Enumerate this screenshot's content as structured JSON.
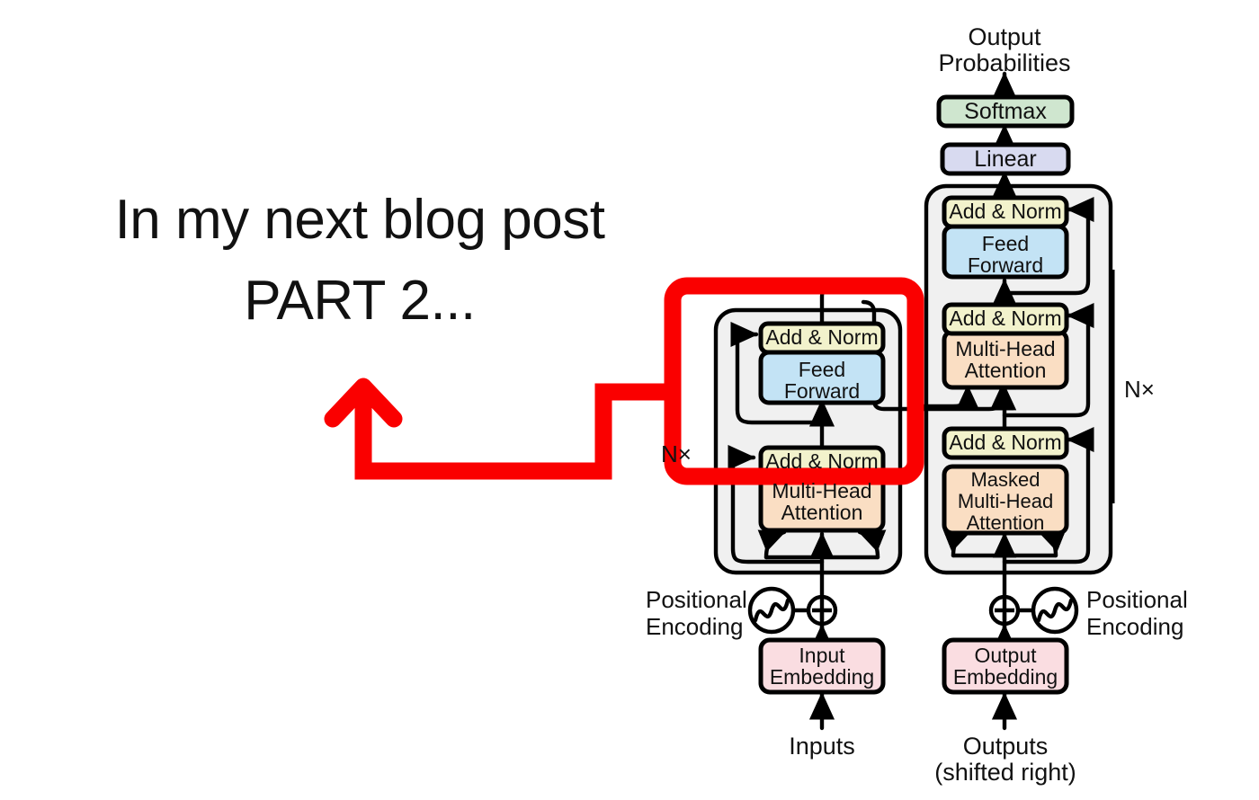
{
  "annotation": {
    "line1": "In my next blog post",
    "line2": "PART 2...",
    "arrow_color": "#fa0000",
    "highlight_color": "#fa0000",
    "arrow_name": "red-callout-arrow",
    "highlight_target": "encoder-stack"
  },
  "diagram": {
    "title_hidden": "",
    "top_labels": {
      "output_probabilities_line1": "Output",
      "output_probabilities_line2": "Probabilities"
    },
    "blocks": {
      "softmax": "Softmax",
      "linear": "Linear",
      "add_norm": "Add & Norm",
      "feed_forward_line1": "Feed",
      "feed_forward_line2": "Forward",
      "multi_head_line1": "Multi-Head",
      "multi_head_line2": "Attention",
      "masked_mha_line1": "Masked",
      "masked_mha_line2": "Multi-Head",
      "masked_mha_line3": "Attention",
      "input_embedding_line1": "Input",
      "input_embedding_line2": "Embedding",
      "output_embedding_line1": "Output",
      "output_embedding_line2": "Embedding"
    },
    "repeat_labels": {
      "encoder_nx": "N×",
      "decoder_nx": "N×"
    },
    "positional": {
      "left_line1": "Positional",
      "left_line2": "Encoding",
      "right_line1": "Positional",
      "right_line2": "Encoding"
    },
    "bottom_labels": {
      "inputs": "Inputs",
      "outputs_line1": "Outputs",
      "outputs_line2": "(shifted right)"
    },
    "colors": {
      "add_norm": "#f2f2cc",
      "feed_forward": "#c3e3f5",
      "attention": "#fadec3",
      "embedding": "#fadde1",
      "softmax": "#cfe6cf",
      "linear": "#d8daf0",
      "stack_panel": "#f0f0f0",
      "stroke": "#000000",
      "background": "#ffffff"
    }
  }
}
